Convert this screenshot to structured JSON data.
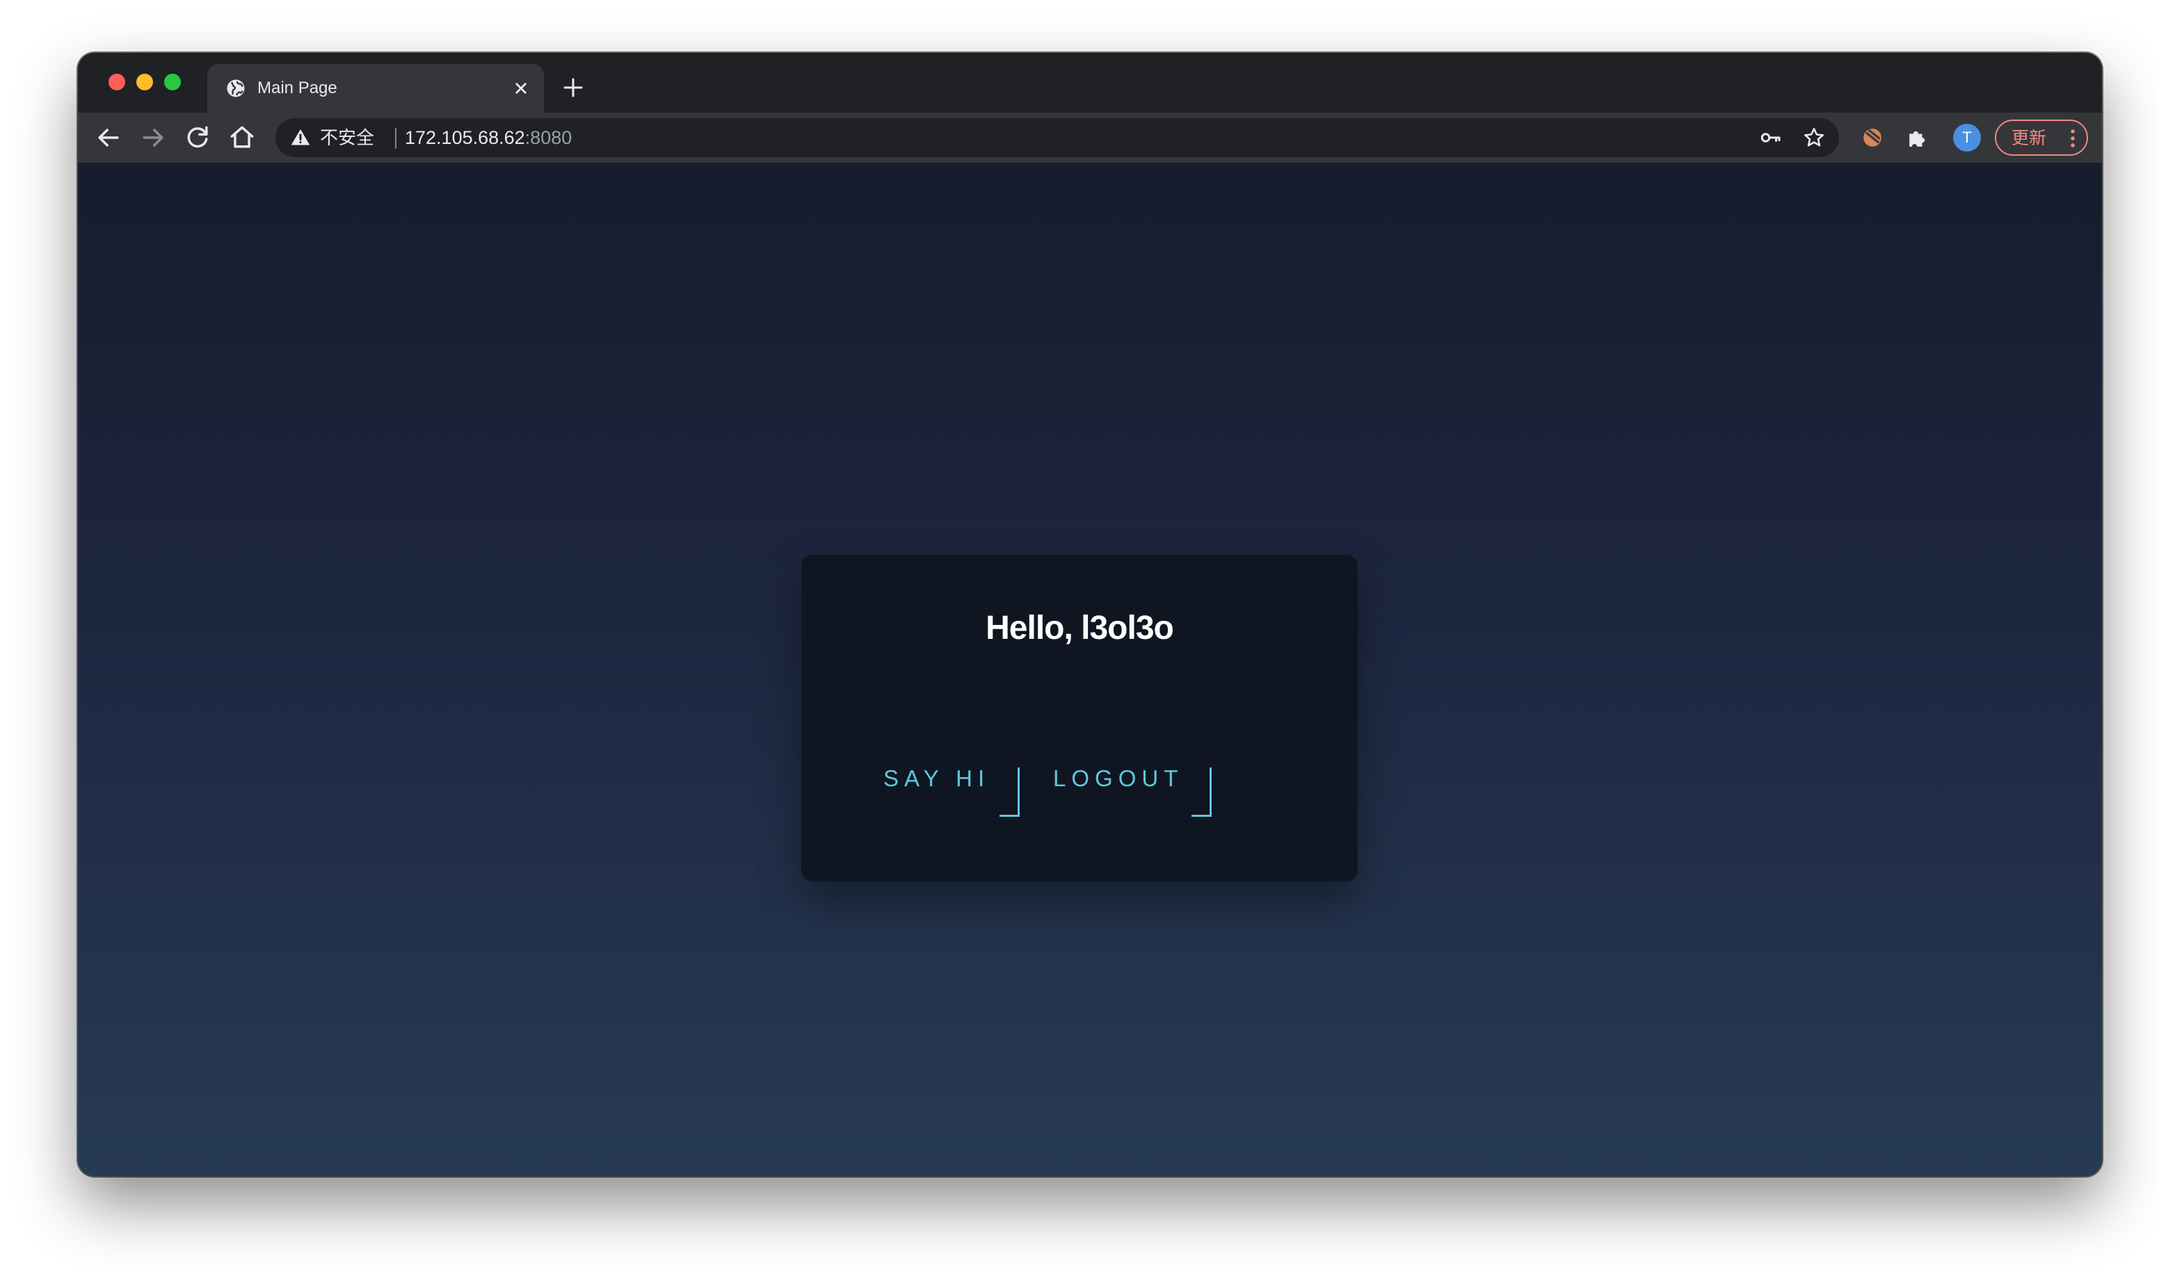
{
  "browser": {
    "tab": {
      "title": "Main Page",
      "favicon": "globe-icon"
    },
    "address_bar": {
      "security_label": "不安全",
      "host": "172.105.68.62",
      "port": ":8080"
    },
    "update_button_label": "更新",
    "profile_initial": "T",
    "icons": {
      "back": "arrow-left-icon",
      "forward": "arrow-right-icon",
      "reload": "reload-icon",
      "home": "home-icon",
      "key": "key-icon",
      "bookmark": "star-icon",
      "extension_1": "extension-badge-icon",
      "extensions": "puzzle-icon",
      "menu": "kebab-menu-icon"
    }
  },
  "page": {
    "greeting": "Hello, l3ol3o",
    "buttons": {
      "say_hi": "SAY HI",
      "logout": "LOGOUT"
    }
  },
  "colors": {
    "accent": "#5fc8dc",
    "card_background": "#101621",
    "page_gradient_top": "#161c2c",
    "page_gradient_bottom": "#273a55",
    "update_button": "#f28b82",
    "avatar": "#4a90e2"
  }
}
